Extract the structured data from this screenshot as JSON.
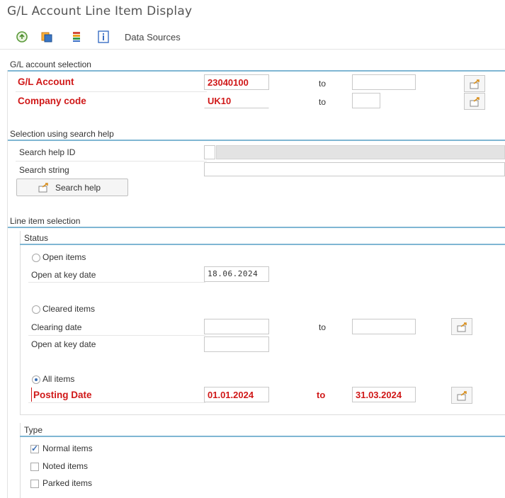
{
  "window": {
    "title": "G/L Account Line Item Display"
  },
  "toolbar": {
    "icons": [
      "execute-icon",
      "copy-icon",
      "list-icon",
      "info-icon"
    ],
    "data_sources_label": "Data Sources"
  },
  "gl_selection": {
    "section_title": "G/L account selection",
    "gl_account": {
      "label": "G/L Account",
      "from": "23040100",
      "to_label": "to",
      "to": ""
    },
    "company_code": {
      "label": "Company code",
      "from": "UK10",
      "to_label": "to",
      "to": ""
    }
  },
  "search_help": {
    "section_title": "Selection using search help",
    "search_help_id_label": "Search help ID",
    "search_string_label": "Search string",
    "button_label": "Search help"
  },
  "line_items": {
    "section_title": "Line item selection",
    "status": {
      "group_title": "Status",
      "open_items_label": "Open items",
      "open_key_date_label": "Open at key date",
      "open_key_date_value": "18.06.2024",
      "cleared_items_label": "Cleared items",
      "clearing_date_label": "Clearing date",
      "clearing_to_label": "to",
      "cleared_open_key_date_label": "Open at key date",
      "all_items_label": "All items",
      "posting_date_label": "Posting Date",
      "posting_date_from": "01.01.2024",
      "posting_to_label": "to",
      "posting_date_to": "31.03.2024",
      "selected": "all_items"
    },
    "type": {
      "group_title": "Type",
      "normal_items_label": "Normal items",
      "noted_items_label": "Noted items",
      "parked_items_label": "Parked items",
      "normal_checked": true,
      "noted_checked": false,
      "parked_checked": false
    }
  }
}
